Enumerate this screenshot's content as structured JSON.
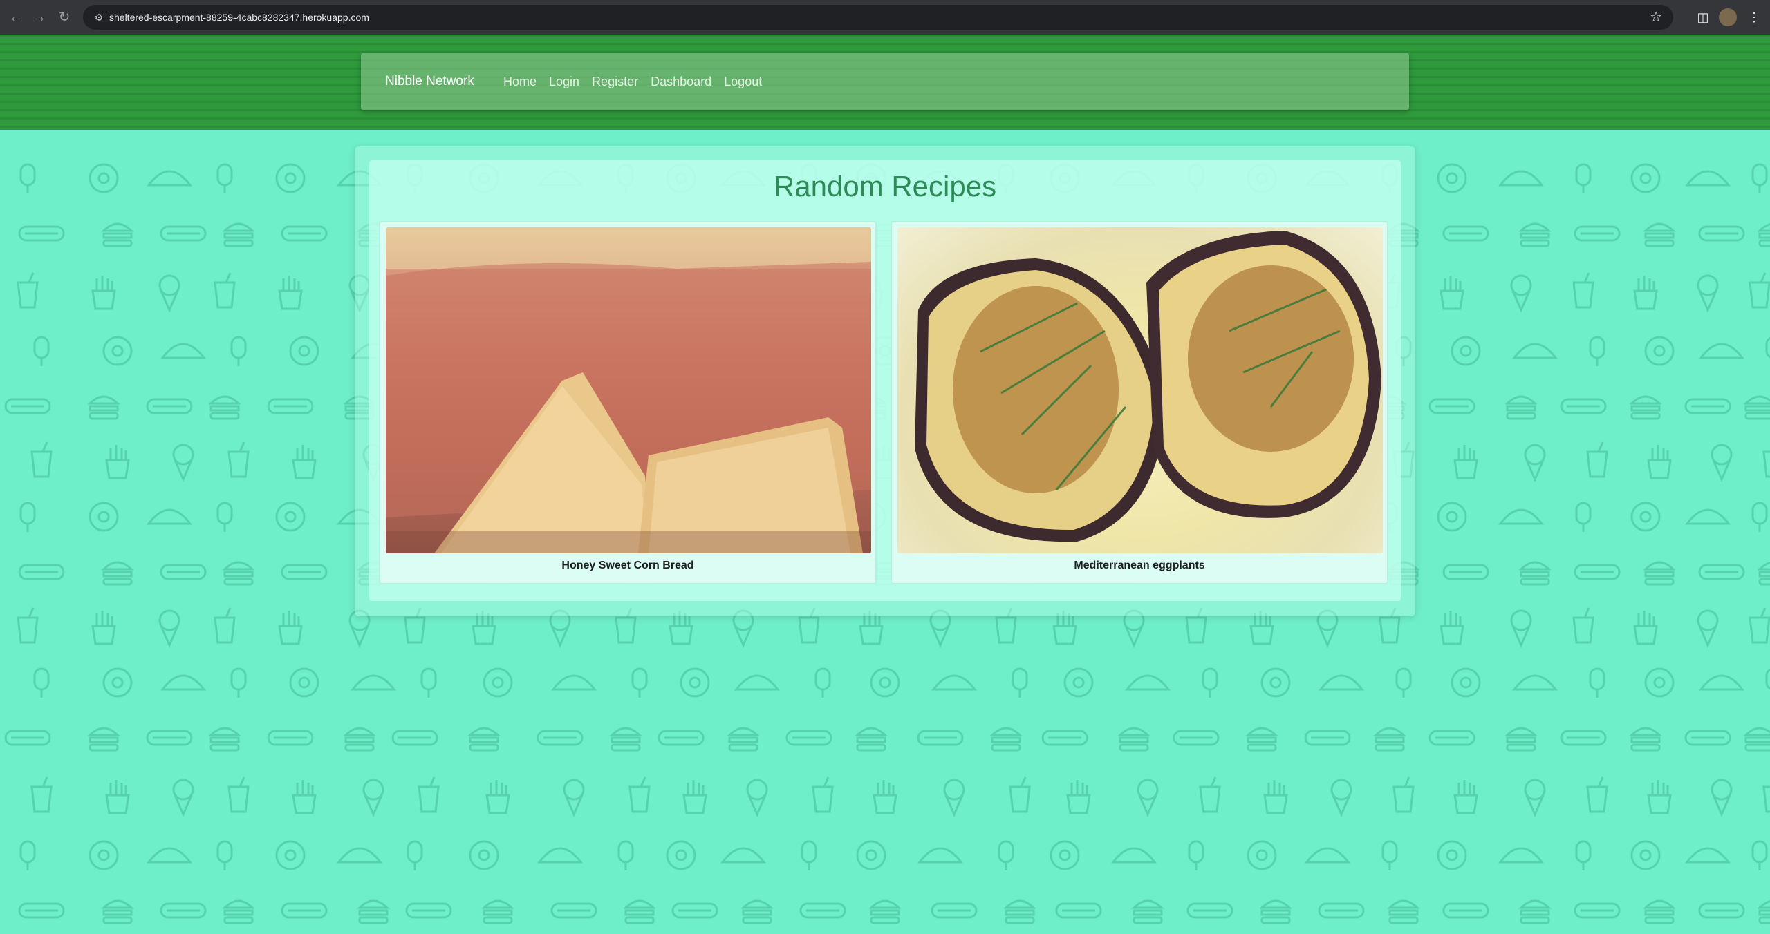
{
  "browser": {
    "url": "sheltered-escarpment-88259-4cabc8282347.herokuapp.com"
  },
  "navbar": {
    "brand": "Nibble Network",
    "links": [
      "Home",
      "Login",
      "Register",
      "Dashboard",
      "Logout"
    ]
  },
  "main": {
    "title": "Random Recipes",
    "recipes": [
      {
        "title": "Honey Sweet Corn Bread"
      },
      {
        "title": "Mediterranean eggplants"
      }
    ]
  },
  "colors": {
    "header": "#2e9a3c",
    "background": "#6eeec9",
    "title": "#2e8b57"
  }
}
